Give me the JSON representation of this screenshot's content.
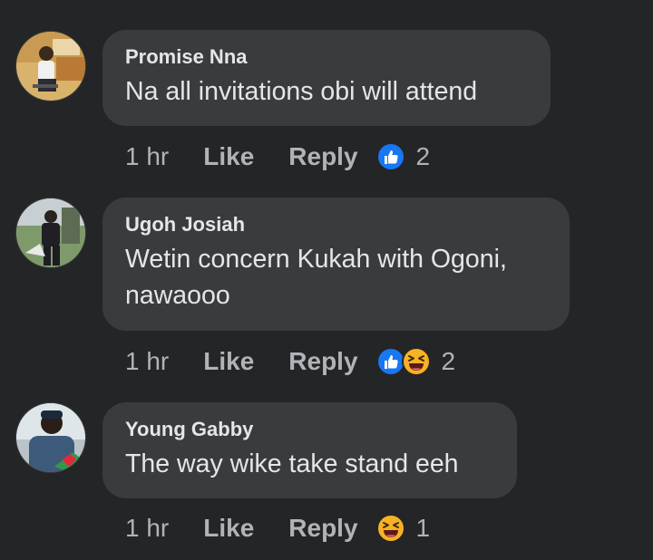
{
  "colors": {
    "background": "#242526",
    "bubble": "#3a3b3c",
    "primary_text": "#e4e6eb",
    "secondary_text": "#b0b3b8",
    "like_blue": "#1877f2",
    "haha_yellow": "#f7b125"
  },
  "comments": [
    {
      "author": "Promise Nna",
      "text": "Na all invitations obi will attend",
      "time": "1 hr",
      "like_label": "Like",
      "reply_label": "Reply",
      "reactions": [
        "like-icon"
      ],
      "reaction_count": "2"
    },
    {
      "author": "Ugoh Josiah",
      "text": "Wetin concern Kukah with Ogoni, nawaooo",
      "time": "1 hr",
      "like_label": "Like",
      "reply_label": "Reply",
      "reactions": [
        "like-icon",
        "haha-icon"
      ],
      "reaction_count": "2"
    },
    {
      "author": "Young Gabby",
      "text": "The way wike take stand eeh",
      "time": "1 hr",
      "like_label": "Like",
      "reply_label": "Reply",
      "reactions": [
        "haha-icon"
      ],
      "reaction_count": "1"
    }
  ]
}
